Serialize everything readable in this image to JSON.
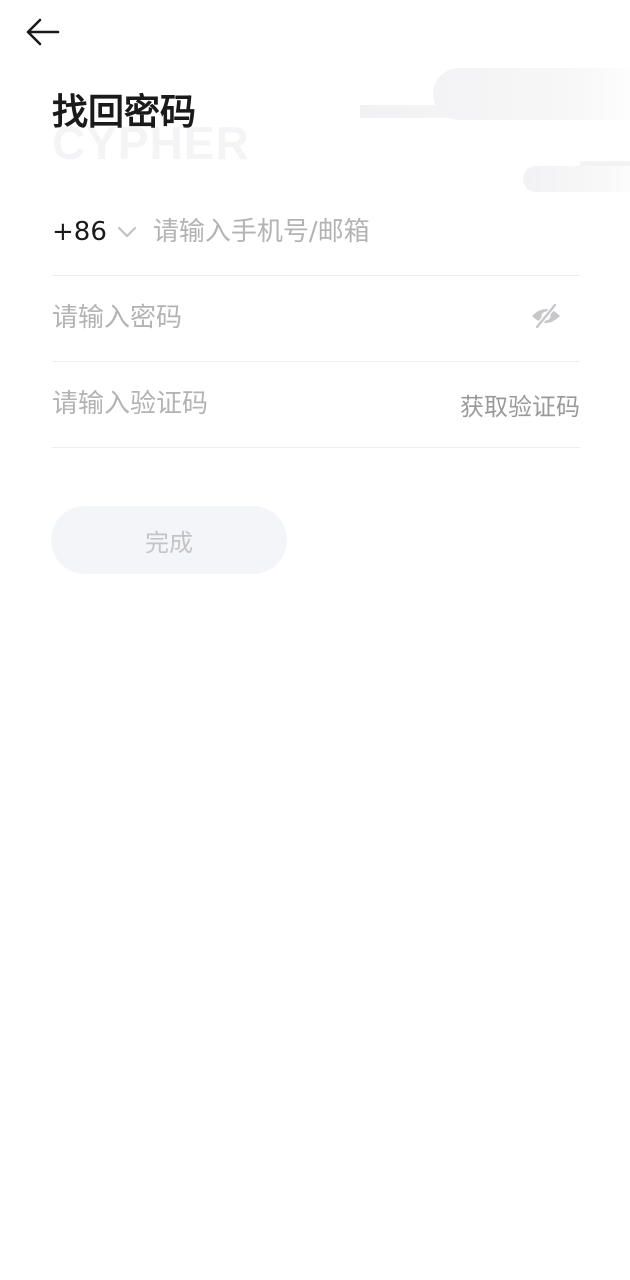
{
  "header": {
    "back_icon": "arrow-left-icon",
    "title": "找回密码",
    "watermark": "CYPHER"
  },
  "form": {
    "country_code": "+86",
    "country_chevron_icon": "chevron-down-icon",
    "account_placeholder": "请输入手机号/邮箱",
    "password_placeholder": "请输入密码",
    "password_visibility_icon": "eye-off-icon",
    "code_placeholder": "请输入验证码",
    "get_code_label": "获取验证码"
  },
  "actions": {
    "done_label": "完成"
  },
  "colors": {
    "title": "#1a1a1a",
    "placeholder": "#b3b3b6",
    "divider": "#eeeeef",
    "button_bg": "#f4f5f8",
    "button_text": "#c4c4c7"
  }
}
